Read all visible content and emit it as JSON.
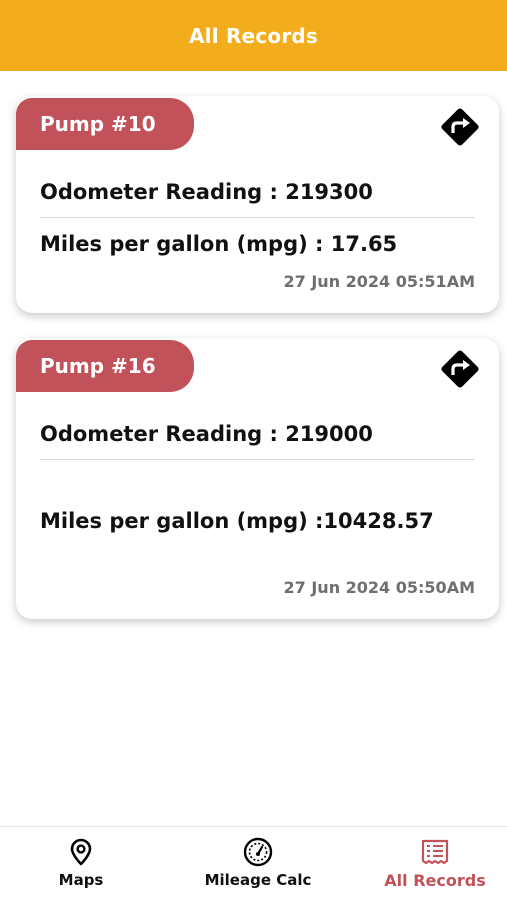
{
  "header": {
    "title": "All Records"
  },
  "records": [
    {
      "pump_label": "Pump #10",
      "odometer_text": "Odometer Reading : 219300",
      "mpg_text": "Miles per gallon (mpg) : 17.65",
      "timestamp": "27 Jun 2024 05:51AM"
    },
    {
      "pump_label": "Pump #16",
      "odometer_text": "Odometer Reading : 219000",
      "mpg_text": "Miles per gallon (mpg) :10428.57",
      "timestamp": "27 Jun 2024 05:50AM"
    }
  ],
  "icons": {
    "directions": "directions-icon",
    "maps": "map-pin-icon",
    "mileage": "speedometer-icon",
    "records": "receipt-icon"
  },
  "bottom_nav": {
    "items": [
      {
        "label": "Maps",
        "active": false
      },
      {
        "label": "Mileage Calc",
        "active": false
      },
      {
        "label": "All Records",
        "active": true
      }
    ]
  },
  "colors": {
    "header_bg": "#f3ad1c",
    "pump_tab_bg": "#c2525a",
    "active_nav": "#c2525a",
    "timestamp": "#6f6f6f"
  }
}
